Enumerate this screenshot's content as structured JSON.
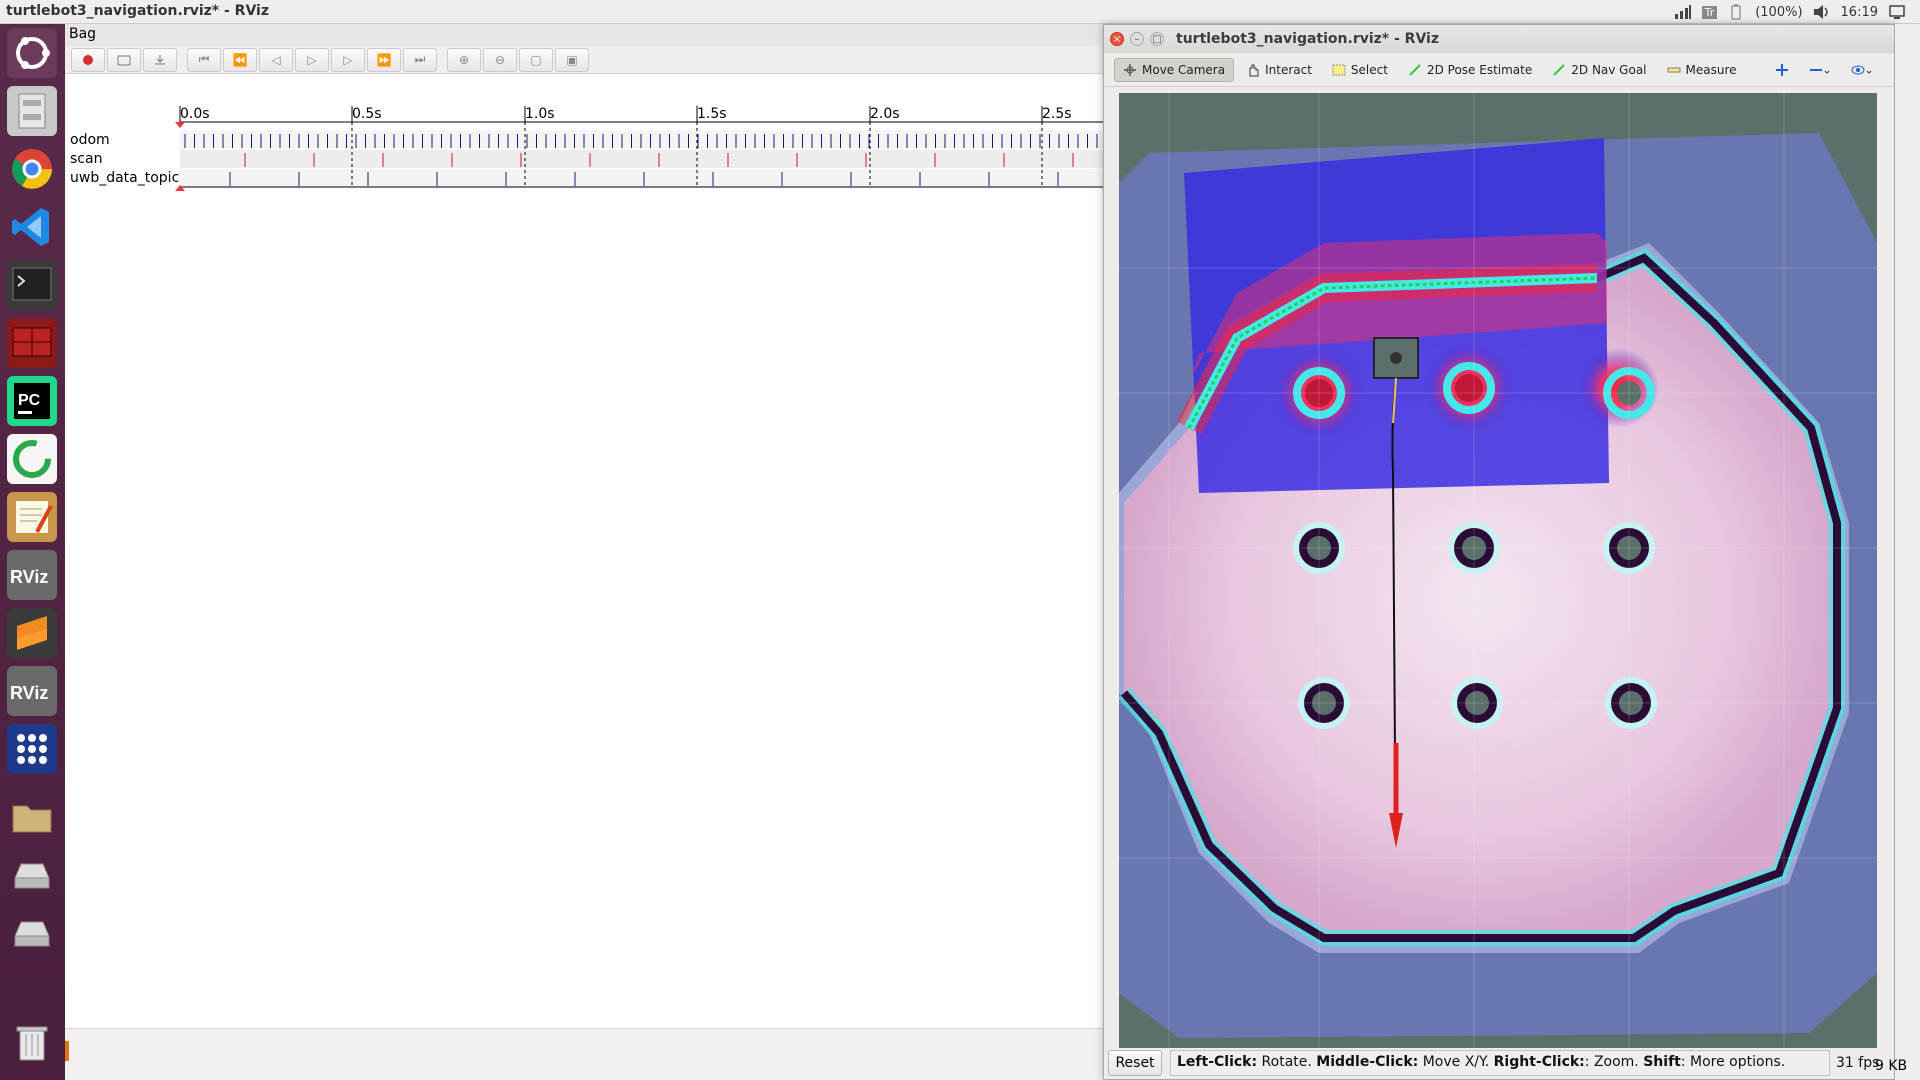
{
  "top_panel": {
    "window_title": "turtlebot3_navigation.rviz* - RViz",
    "battery": "(100%)",
    "clock": "16:19",
    "keyboard": "Tr"
  },
  "launcher": {
    "items": [
      "ubuntu-dash",
      "files",
      "chrome",
      "vscode",
      "terminal",
      "terminator",
      "pycharm",
      "app-ring",
      "text-editor",
      "rviz",
      "sublime",
      "rviz-2",
      "app-grid",
      "folder",
      "drive-1",
      "drive-2",
      "trash"
    ]
  },
  "bag": {
    "title": "Bag",
    "topics": [
      "odom",
      "scan",
      "uwb_data_topic"
    ],
    "ticks": [
      "0.0s",
      "0.5s",
      "1.0s",
      "1.5s",
      "2.0s",
      "2.5s"
    ],
    "status_right": "9 KB"
  },
  "rviz": {
    "title": "turtlebot3_navigation.rviz* - RViz",
    "tools": {
      "move_camera": "Move Camera",
      "interact": "Interact",
      "select": "Select",
      "pose_estimate": "2D Pose Estimate",
      "nav_goal": "2D Nav Goal",
      "measure": "Measure"
    },
    "reset": "Reset",
    "hint": {
      "left_key": "Left-Click:",
      "left_val": " Rotate. ",
      "mid_key": "Middle-Click:",
      "mid_val": " Move X/Y. ",
      "right_key": "Right-Click:",
      "right_val": ": Zoom. ",
      "shift_key": "Shift",
      "shift_val": ": More options."
    },
    "fps": "31 fps"
  },
  "colors": {
    "launcher_bg": "#4a1f3d",
    "map_dark": "#2a0c36",
    "costmap_blue": "#3a2ee0",
    "inflation_cyan": "#45e8e8",
    "goal_arrow": "#e0201c"
  }
}
